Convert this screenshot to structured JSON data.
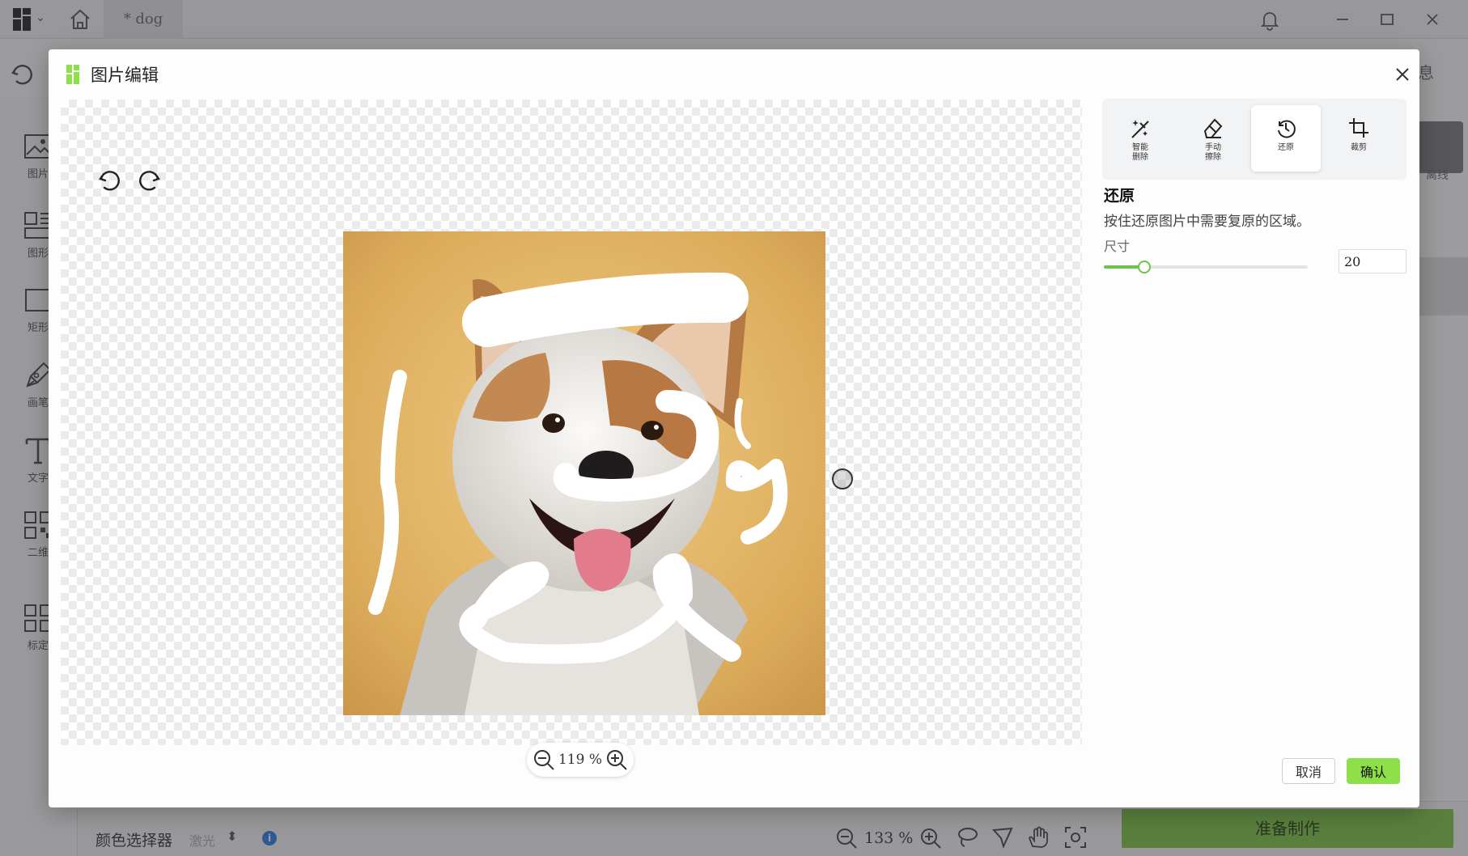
{
  "app": {
    "tab_label": "* dog",
    "sidebar": [
      {
        "label": "图片",
        "icon": "image-icon"
      },
      {
        "label": "图形",
        "icon": "shapes-icon"
      },
      {
        "label": "矩形",
        "icon": "rectangle-icon"
      },
      {
        "label": "画笔",
        "icon": "pen-icon"
      },
      {
        "label": "文字",
        "icon": "text-icon"
      },
      {
        "label": "二维码",
        "icon": "qrcode-icon"
      },
      {
        "label": "标定",
        "icon": "grid-icon"
      }
    ],
    "right_panel": {
      "info_label": "息",
      "offline_label": "离线"
    },
    "bottom": {
      "color_picker_label": "颜色选择器",
      "color_picker_value": "激光",
      "zoom_value": "133 %",
      "prepare_button": "准备制作"
    }
  },
  "dialog": {
    "title": "图片编辑",
    "zoom_value": "119 %",
    "tools": [
      {
        "label": "智能\n删除",
        "icon": "magic-wand-icon",
        "active": false
      },
      {
        "label": "手动\n擦除",
        "icon": "eraser-icon",
        "active": false
      },
      {
        "label": "还原",
        "icon": "restore-icon",
        "active": true
      },
      {
        "label": "裁剪",
        "icon": "crop-icon",
        "active": false
      }
    ],
    "section_title": "还原",
    "section_desc": "按住还原图片中需要复原的区域。",
    "size_label": "尺寸",
    "size_value": "20",
    "size_slider_fraction": 0.2,
    "cancel_label": "取消",
    "confirm_label": "确认",
    "accent_color": "#8ee04a"
  }
}
